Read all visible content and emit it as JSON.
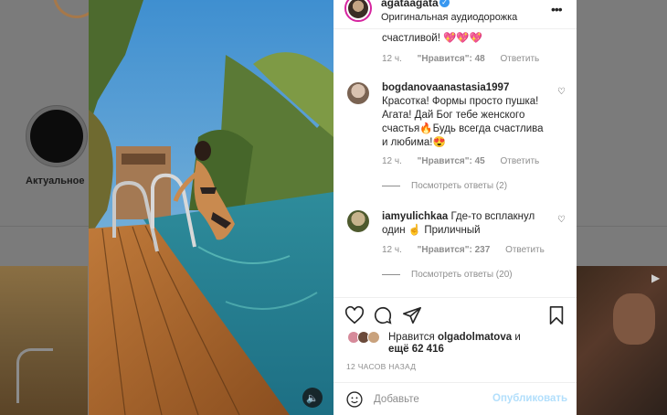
{
  "background": {
    "highlight_label": "Актуальное"
  },
  "post": {
    "username": "agataagata",
    "audio_label": "Оригинальная аудиодорожка",
    "more_icon": "more-horizontal-icon"
  },
  "comments": [
    {
      "text": "счастливой! 💖💖💖",
      "time": "12 ч.",
      "likes": "\"Нравится\": 48",
      "reply": "Ответить"
    },
    {
      "user": "bogdanovaanastasia1997",
      "text_lines": [
        "Красотка! Формы просто пушка!",
        "Агата! Дай Бог тебе женского",
        "счастья🔥Будь всегда счастлива",
        "и любима!😍"
      ],
      "time": "12 ч.",
      "likes": "\"Нравится\": 45",
      "reply": "Ответить",
      "view_replies": "Посмотреть ответы (2)"
    },
    {
      "user": "iamyulichkaa",
      "text_first": "Где-то всплакнул",
      "text_second": "один ☝ Приличный",
      "time": "12 ч.",
      "likes": "\"Нравится\": 237",
      "reply": "Ответить",
      "view_replies": "Посмотреть ответы (20)"
    }
  ],
  "likes": {
    "prefix": "Нравится",
    "user": "olgadolmatova",
    "suffix": "и",
    "others": "ещё 62 416"
  },
  "timestamp": "12 ЧАСОВ НАЗАД",
  "comment_input": {
    "placeholder": "Добавьте",
    "publish_label": "Опубликовать"
  }
}
